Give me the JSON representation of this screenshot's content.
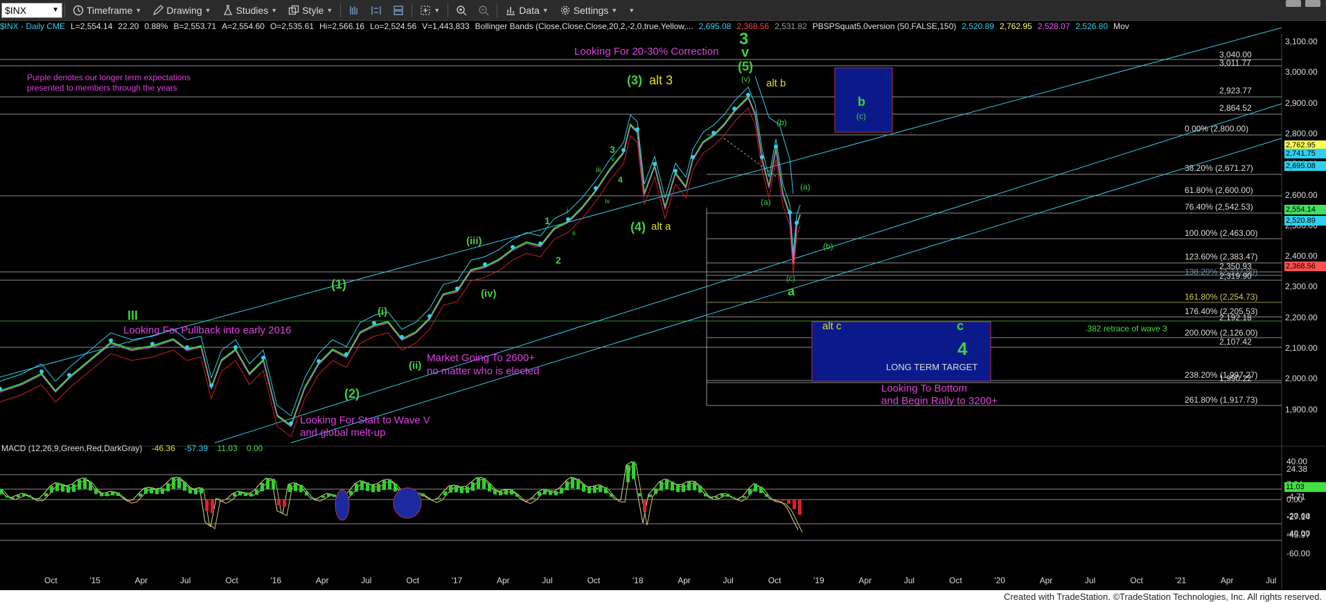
{
  "toolbar": {
    "symbol": "$INX",
    "items": [
      "Timeframe",
      "Drawing",
      "Studies",
      "Style",
      "Data",
      "Settings"
    ]
  },
  "infobar": {
    "items": [
      {
        "text": "$INX - Daily  CME",
        "color": "#2fd0f0"
      },
      {
        "text": "L=2,554.14",
        "color": "#e0e0e0"
      },
      {
        "text": "22.20",
        "color": "#e0e0e0"
      },
      {
        "text": "0.88%",
        "color": "#e0e0e0"
      },
      {
        "text": "B=2,553.71",
        "color": "#e0e0e0"
      },
      {
        "text": "A=2,554.60",
        "color": "#e0e0e0"
      },
      {
        "text": "O=2,535.61",
        "color": "#e0e0e0"
      },
      {
        "text": "Hi=2,566.16",
        "color": "#e0e0e0"
      },
      {
        "text": "Lo=2,524.56",
        "color": "#e0e0e0"
      },
      {
        "text": "V=1,443,833",
        "color": "#e0e0e0"
      },
      {
        "text": "Bollinger Bands (Close,Close,Close,20,2,-2,0,true,Yellow,...",
        "color": "#e0e0e0"
      },
      {
        "text": "2,695.08",
        "color": "#2fd0f0"
      },
      {
        "text": "2,368.56",
        "color": "#ff4040"
      },
      {
        "text": "2,531.82",
        "color": "#9aa0a0"
      },
      {
        "text": "PBSPSquat5.0version (50,FALSE,150)",
        "color": "#e0e0e0"
      },
      {
        "text": "2,520.89",
        "color": "#2fd0f0"
      },
      {
        "text": "2,762.95",
        "color": "#ffff60"
      },
      {
        "text": "2,528.07",
        "color": "#ff50ff"
      },
      {
        "text": "2,526.80",
        "color": "#2fd0f0"
      },
      {
        "text": "Mov",
        "color": "#e0e0e0"
      }
    ]
  },
  "price_axis": [
    "3,100.00",
    "3,000.00",
    "2,900.00",
    "2,800.00",
    "2,700.00",
    "2,600.00",
    "2,500.00",
    "2,400.00",
    "2,300.00",
    "2,200.00",
    "2,100.00",
    "2,000.00",
    "1,900.00"
  ],
  "price_tags": [
    {
      "text": "2,762.95",
      "bg": "#ffff50"
    },
    {
      "text": "2,741.75",
      "bg": "#2fd0f0"
    },
    {
      "text": "2,695.08",
      "bg": "#2fd0f0"
    },
    {
      "text": "2,554.14",
      "bg": "#40e060"
    },
    {
      "text": "2,520.89",
      "bg": "#2fd0f0"
    },
    {
      "text": "2,368.56",
      "bg": "#ff5050"
    }
  ],
  "fib_labels": [
    "3,040.00",
    "3,011.77",
    "2,923.77",
    "2,864.52",
    "0.00% (2,800.00)",
    "38.20% (2,671.27)",
    "61.80% (2,600.00)",
    "76.40% (2,542.53)",
    "100.00% (2,463.00)",
    "123.60% (2,383.47)",
    "2,350.93",
    "138.20% (2,337.80)",
    "2,319.90",
    "161.80% (2,254.73)",
    "176.40% (2,205.53)",
    "2,192.18",
    "200.00% (2,126.00)",
    "2,107.42",
    "238.20% (1,997.27)",
    "1,990.22",
    "261.80% (1,917.73)"
  ],
  "macd": {
    "title": "MACD (12,26,9,Green,Red,DarkGray)",
    "values": [
      "-46.36",
      "-57.39",
      "11.03",
      "0.00"
    ],
    "axis": [
      "40.00",
      "24.38",
      "7.34",
      "-4.71",
      "0.00",
      "-20.00",
      "-27.14",
      "-40.00",
      "-45.97",
      "-60.00"
    ],
    "tag": "11.03"
  },
  "date_axis": [
    "Oct",
    "'15",
    "Apr",
    "Jul",
    "Oct",
    "'16",
    "Apr",
    "Jul",
    "Oct",
    "'17",
    "Apr",
    "Jul",
    "Oct",
    "'18",
    "Apr",
    "Jul",
    "Oct",
    "'19",
    "Apr",
    "Jul",
    "Oct",
    "'20",
    "Apr",
    "Jul",
    "Oct",
    "'21",
    "Apr",
    "Jul"
  ],
  "annotations": {
    "purple_note_line1": "Purple denotes our longer term expectations",
    "purple_note_line2": "presented to members through the years",
    "correction": "Looking For 20-30% Correction",
    "pullback": "Looking For Pullback into early 2016",
    "market_2600_1": "Market Going To 2600+",
    "market_2600_2": "no matter who is elected",
    "wave_v_1": "Looking For Start to Wave V",
    "wave_v_2": "and global melt-up",
    "bottom_1": "Looking To Bottom",
    "bottom_2": "and Begin Rally to 3200+",
    "long_term_target": "LONG TERM TARGET",
    "retrace": ".382 retrace of wave 3",
    "w_III": "III",
    "w_1": "(1)",
    "w_2": "(2)",
    "w_i": "(i)",
    "w_ii": "(ii)",
    "w_iii": "(iii)",
    "w_iv": "(iv)",
    "w_3": "(3)",
    "w_alt3": "alt 3",
    "w_4": "(4)",
    "w_alta": "alt a",
    "w_5": "(5)",
    "w_big3": "3",
    "w_bigv": "v",
    "w_altb": "alt b",
    "w_v": "(v)",
    "w_b_small": "(b)",
    "w_a_paren1": "(a)",
    "w_a_paren2": "(a)",
    "w_b_paren2": "(b)",
    "w_c_paren": "(c)",
    "w_a": "a",
    "w_b": "b",
    "w_c_box": "(c)",
    "w_altc": "alt c",
    "w_c": "c",
    "w_4big": "4",
    "w_1s": "1",
    "w_2s": "2",
    "w_3s": "3",
    "w_4s": "4",
    "w_iiis": "iii",
    "w_ivs": "iv",
    "w_vs": "v",
    "w_is": "i",
    "w_iis": "ii"
  },
  "footer": "Created with TradeStation. ©TradeStation Technologies, Inc. All rights reserved."
}
